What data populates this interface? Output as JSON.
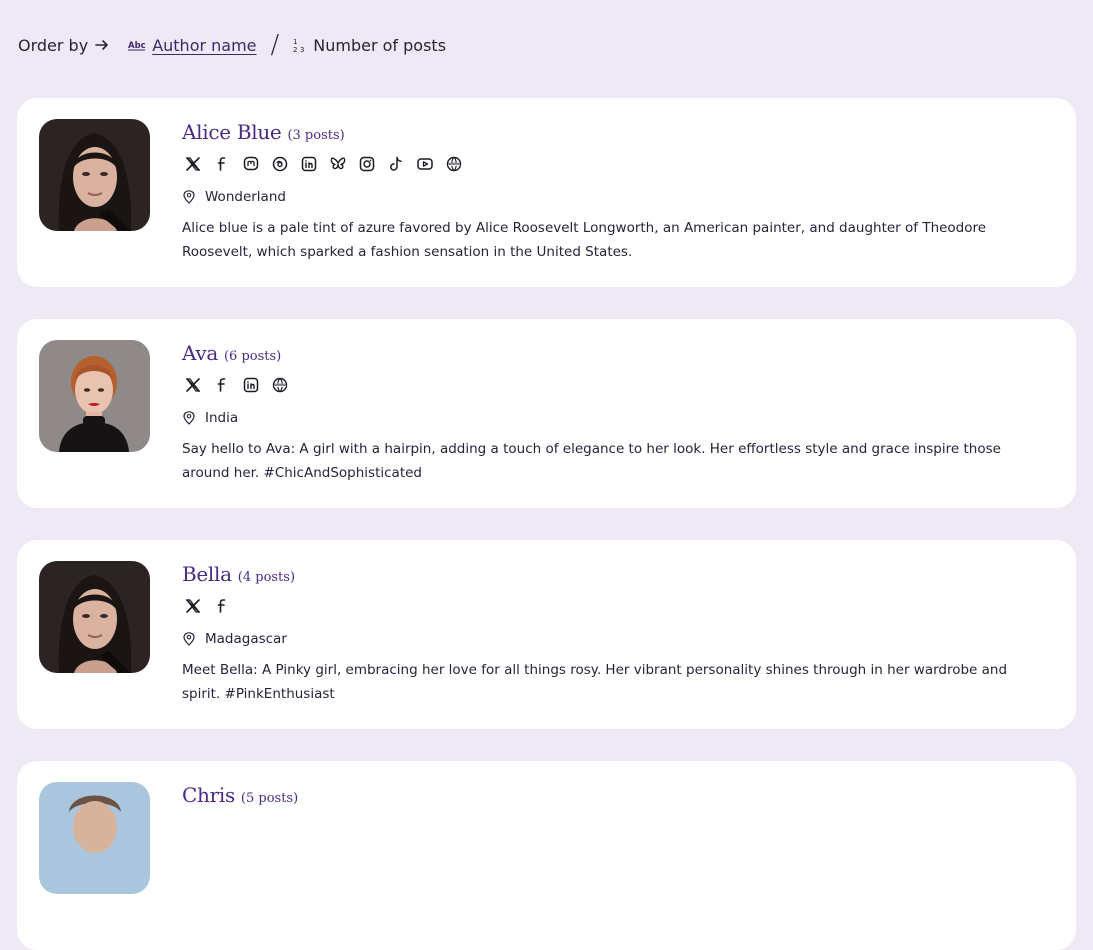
{
  "order_bar": {
    "label": "Order by",
    "options": [
      {
        "label": "Author name",
        "icon": "abc-icon",
        "active": true
      },
      {
        "label": "Number of posts",
        "icon": "numbers-icon",
        "active": false
      }
    ],
    "separator": "/"
  },
  "authors": [
    {
      "name": "Alice Blue",
      "posts": "(3 posts)",
      "socials": [
        "x-icon",
        "facebook-icon",
        "mastodon-icon",
        "threads-icon",
        "linkedin-icon",
        "bluesky-icon",
        "instagram-icon",
        "tiktok-icon",
        "youtube-icon",
        "website-icon"
      ],
      "location": "Wonderland",
      "bio": "Alice blue is a pale tint of azure favored by Alice Roosevelt Longworth, an American painter, and daughter of Theodore Roosevelt, which sparked a fashion sensation in the United States."
    },
    {
      "name": "Ava",
      "posts": "(6 posts)",
      "socials": [
        "x-icon",
        "facebook-icon",
        "linkedin-icon",
        "website-icon"
      ],
      "location": "India",
      "bio": "Say hello to Ava: A girl with a hairpin, adding a touch of elegance to her look. Her effortless style and grace inspire those around her. #ChicAndSophisticated"
    },
    {
      "name": "Bella",
      "posts": "(4 posts)",
      "socials": [
        "x-icon",
        "facebook-icon"
      ],
      "location": "Madagascar",
      "bio": "Meet Bella: A Pinky girl, embracing her love for all things rosy. Her vibrant personality shines through in her wardrobe and spirit. #PinkEnthusiast"
    },
    {
      "name": "Chris",
      "posts": "(5 posts)",
      "socials": [],
      "location": "",
      "bio": ""
    }
  ],
  "colors": {
    "page_bg": "#efe8f5",
    "card_bg": "#ffffff",
    "name": "#4b2a82",
    "text": "#2a2238"
  }
}
